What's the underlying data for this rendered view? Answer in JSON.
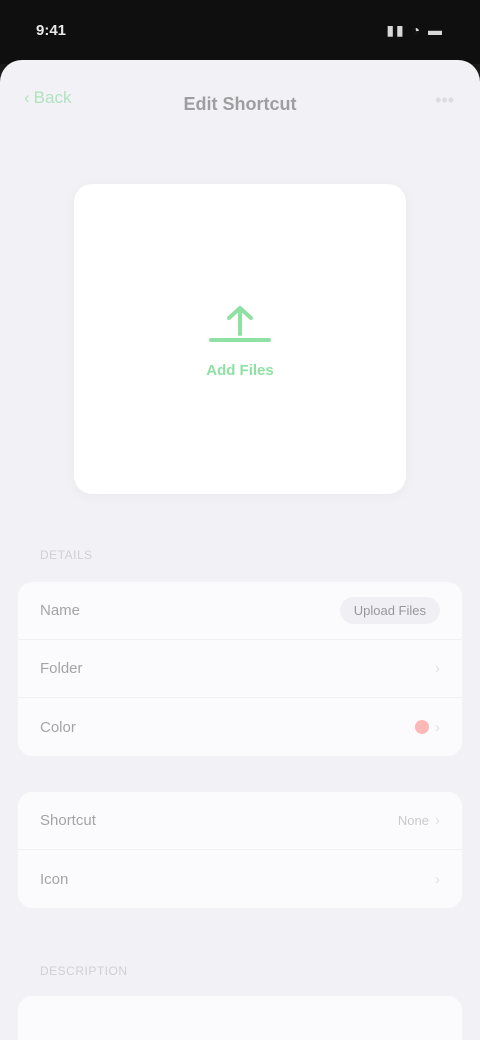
{
  "status_bar": {
    "time": "9:41",
    "icons": "▮▮ ◔ ▬"
  },
  "nav": {
    "back_label": "Back",
    "title": "Edit Shortcut",
    "more_label": "•••"
  },
  "preview": {
    "icon": "upload-icon",
    "label": "Add Files",
    "accent": "#34c759"
  },
  "section1": {
    "header": "Details",
    "rows": [
      {
        "label": "Name",
        "value": "Upload Files"
      },
      {
        "label": "Folder",
        "value": ""
      },
      {
        "label": "Color",
        "value": ""
      }
    ]
  },
  "section2": {
    "rows": [
      {
        "label": "Shortcut",
        "value": "None"
      },
      {
        "label": "Icon",
        "value": ""
      }
    ]
  },
  "section3": {
    "header": "Description"
  },
  "colors": {
    "accent_green": "#34c759",
    "accent_red": "#ff3b30",
    "background": "#f2f2f6"
  }
}
